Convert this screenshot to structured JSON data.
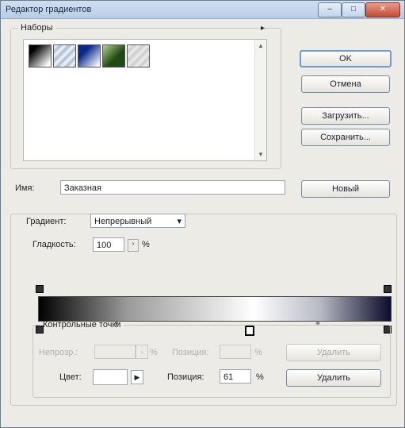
{
  "window": {
    "title": "Редактор градиентов",
    "min": "–",
    "max": "□",
    "close": "✕"
  },
  "presets": {
    "legend": "Наборы",
    "menu_icon": "▸",
    "swatches": [
      {
        "name": "black-white",
        "from": "#000000",
        "to": "#ffffff"
      },
      {
        "name": "transparent-stripes",
        "from": "#b9c6d8",
        "to": "#e6ecf4"
      },
      {
        "name": "blue",
        "from": "#0b2a8d",
        "to": "#ffffff"
      },
      {
        "name": "green",
        "from": "#1f4a14",
        "to": "#a7c487"
      },
      {
        "name": "transparent-diagonal",
        "from": "#e7e7e7",
        "to": "#bfbfbf"
      }
    ]
  },
  "buttons": {
    "ok": "OK",
    "cancel": "Отмена",
    "load": "Загрузить...",
    "save": "Сохранить...",
    "new": "Новый"
  },
  "name_field": {
    "label": "Имя:",
    "value": "Заказная"
  },
  "gradient": {
    "type_label": "Градиент:",
    "type_value": "Непрерывный",
    "smoothness_label": "Гладкость:",
    "smoothness_value": "100",
    "smoothness_unit": "%"
  },
  "stops": {
    "legend": "Контрольные точки",
    "opacity_label": "Непрозр.:",
    "opacity_unit": "%",
    "location_label_1": "Позиция:",
    "location_unit_1": "%",
    "delete_1": "Удалить",
    "color_label": "Цвет:",
    "location_label_2": "Позиция:",
    "location_value_2": "61",
    "location_unit_2": "%",
    "delete_2": "Удалить"
  },
  "colors": {
    "accent": "#6a9bd6",
    "panel": "#ecebe6"
  }
}
